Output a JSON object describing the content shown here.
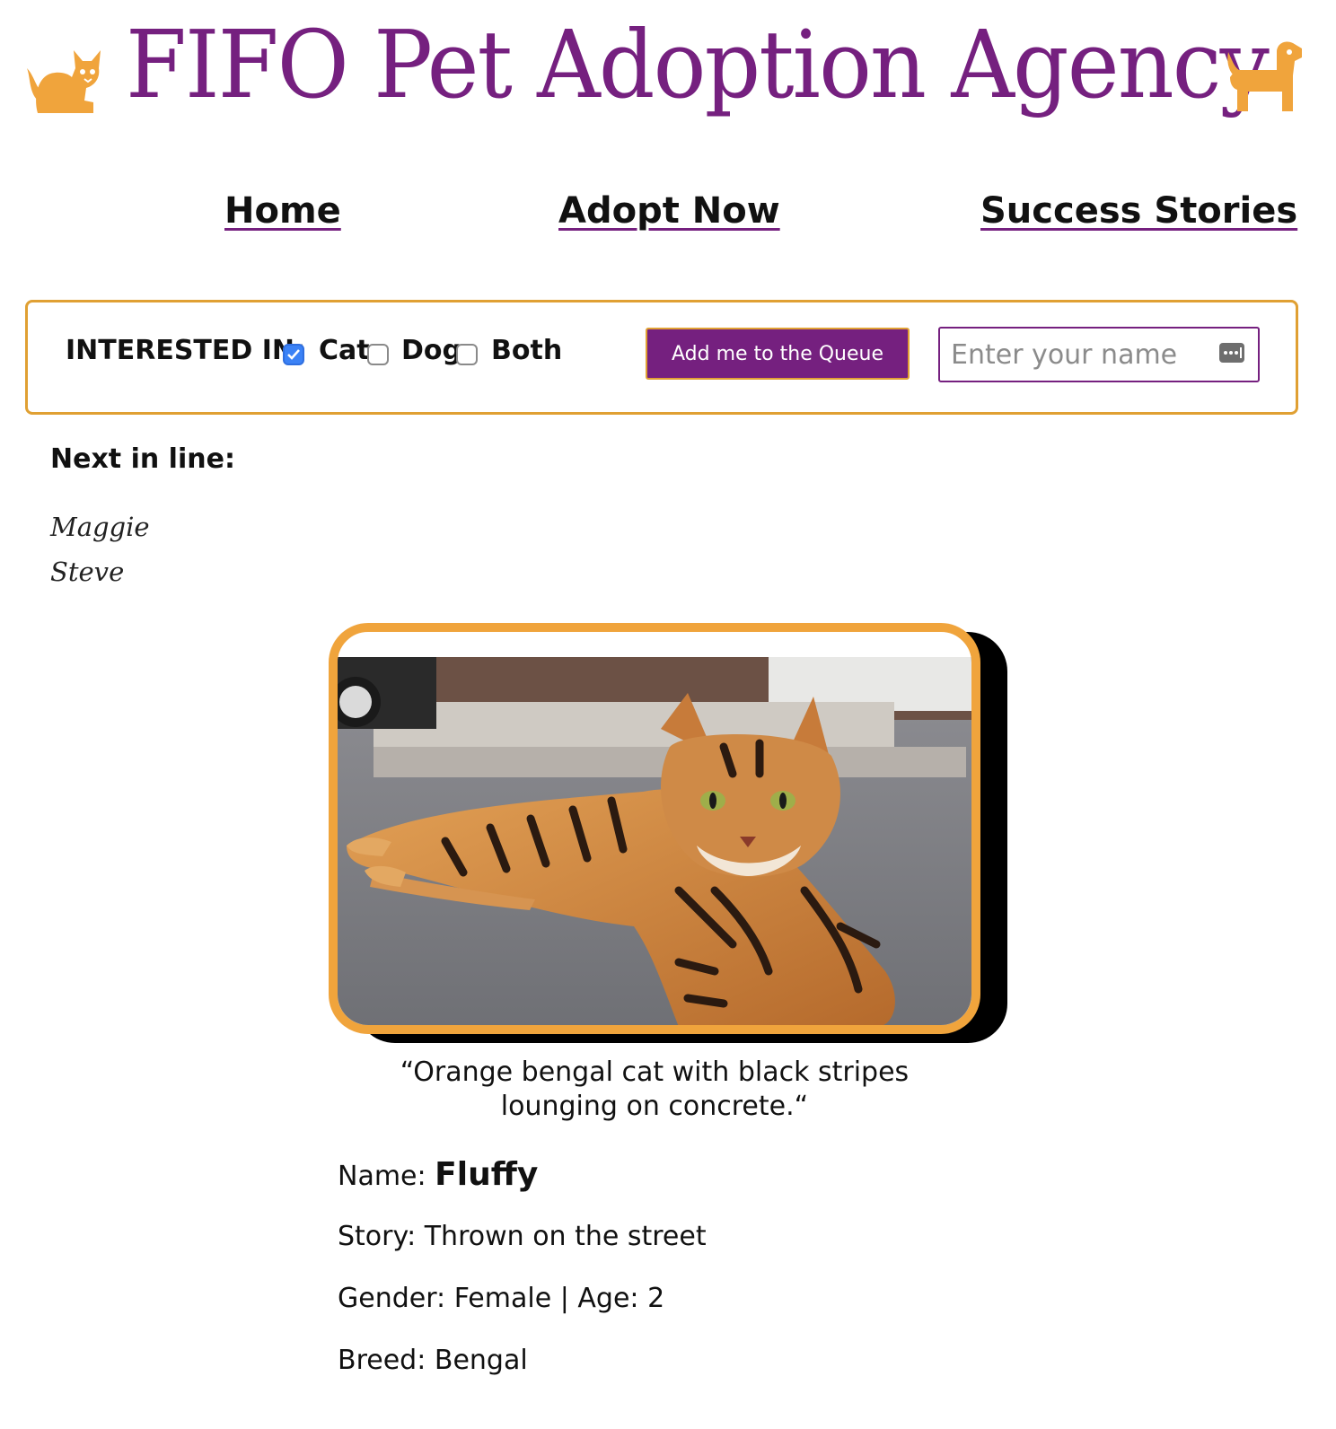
{
  "header": {
    "title": "FIFO Pet Adoption Agency",
    "left_logo_icon": "cat-icon",
    "right_logo_icon": "dog-icon"
  },
  "nav": {
    "items": [
      {
        "label": "Home"
      },
      {
        "label": "Adopt Now"
      },
      {
        "label": "Success Stories"
      }
    ]
  },
  "queue_form": {
    "interested_label": "INTERESTED IN:",
    "options": [
      {
        "label": "Cat",
        "checked": true
      },
      {
        "label": "Dog",
        "checked": false
      },
      {
        "label": "Both",
        "checked": false
      }
    ],
    "button_label": "Add me to the Queue",
    "name_placeholder": "Enter your name",
    "name_value": "",
    "autofill_icon": "password-key-icon"
  },
  "next_in_line": {
    "heading": "Next in line:",
    "people": [
      "Maggie",
      "Steve"
    ]
  },
  "pet": {
    "caption": "“Orange bengal cat with black stripes lounging on concrete.“",
    "name_label": "Name:",
    "name": "Fluffy",
    "story_label": "Story:",
    "story": "Thrown on the street",
    "gender_label": "Gender:",
    "gender": "Female",
    "separator": "|",
    "age_label": "Age:",
    "age": "2",
    "breed_label": "Breed:",
    "breed": "Bengal"
  },
  "colors": {
    "brand_purple": "#75207f",
    "accent_orange": "#f0a43c",
    "checkbox_blue": "#3b82f6"
  }
}
